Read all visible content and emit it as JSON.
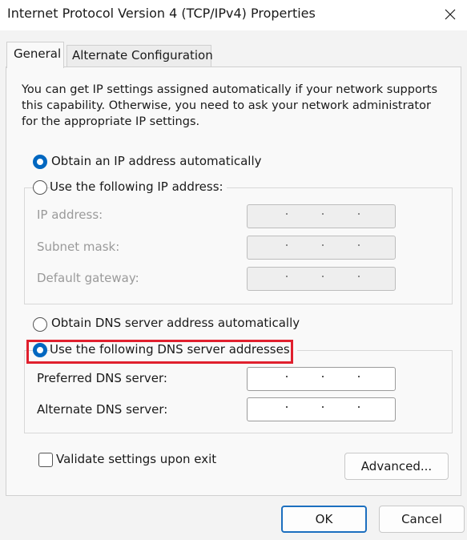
{
  "window": {
    "title": "Internet Protocol Version 4 (TCP/IPv4) Properties",
    "close_icon": "close-icon"
  },
  "tabs": [
    {
      "label": "General",
      "selected": true
    },
    {
      "label": "Alternate Configuration",
      "selected": false
    }
  ],
  "description": "You can get IP settings assigned automatically if your network supports this capability. Otherwise, you need to ask your network administrator for the appropriate IP settings.",
  "ip_section": {
    "auto_radio_label": "Obtain an IP address automatically",
    "auto_selected": true,
    "manual_radio_label": "Use the following IP address:",
    "fields": [
      {
        "label": "IP address:",
        "value": ""
      },
      {
        "label": "Subnet mask:",
        "value": ""
      },
      {
        "label": "Default gateway:",
        "value": ""
      }
    ]
  },
  "dns_section": {
    "auto_radio_label": "Obtain DNS server address automatically",
    "manual_radio_label": "Use the following DNS server addresses:",
    "manual_selected": true,
    "fields": [
      {
        "label": "Preferred DNS server:",
        "value": ""
      },
      {
        "label": "Alternate DNS server:",
        "value": ""
      }
    ]
  },
  "validate_label": "Validate settings upon exit",
  "validate_checked": false,
  "buttons": {
    "advanced": "Advanced...",
    "ok": "OK",
    "cancel": "Cancel"
  },
  "colors": {
    "accent": "#0067c0",
    "highlight": "#e0202e"
  }
}
